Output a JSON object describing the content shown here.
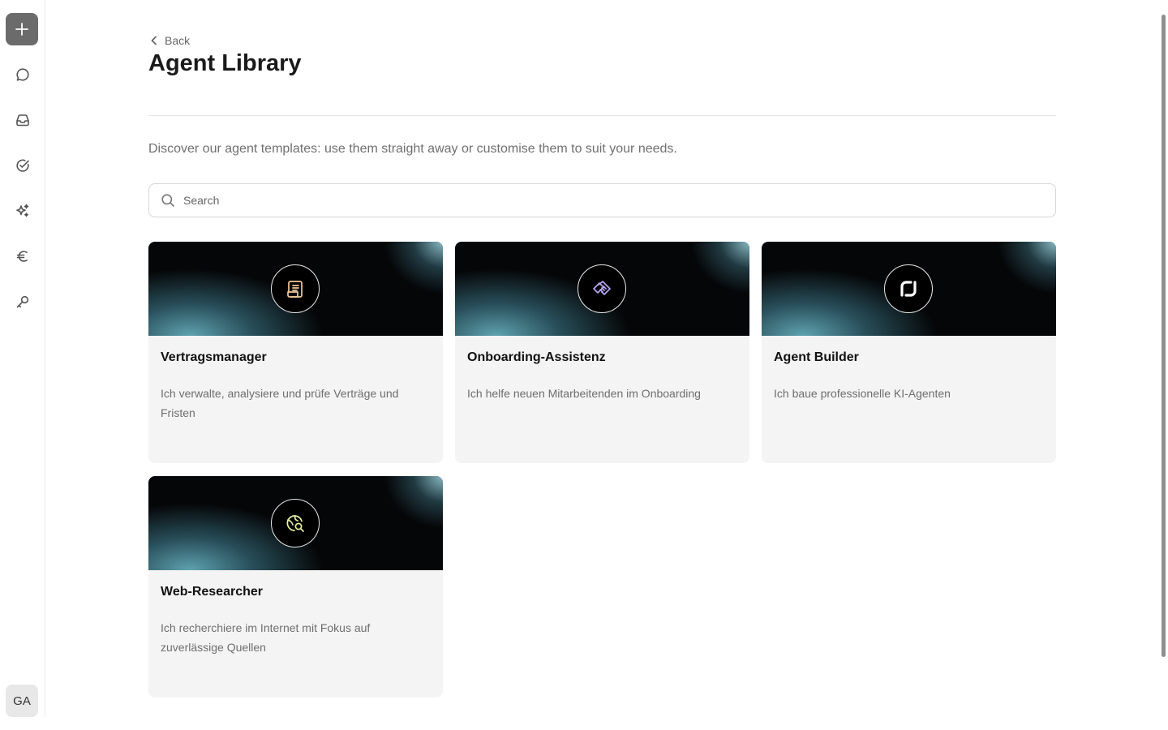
{
  "sidebar": {
    "avatar_initials": "GA",
    "icons": [
      "plus-icon",
      "chat-icon",
      "inbox-icon",
      "check-circle-icon",
      "sparkles-icon",
      "euro-icon",
      "key-icon"
    ]
  },
  "header": {
    "back_label": "Back",
    "title": "Agent Library"
  },
  "description": "Discover our agent templates: use them straight away or customise them to suit your needs.",
  "search": {
    "placeholder": "Search",
    "value": ""
  },
  "cards": [
    {
      "title": "Vertragsmanager",
      "description": "Ich verwalte, analysiere und prüfe Verträge und Fristen",
      "icon": "scroll-icon",
      "icon_color": "#f2c89a"
    },
    {
      "title": "Onboarding-Assistenz",
      "description": "Ich helfe neuen Mitarbeitenden im Onboarding",
      "icon": "handshake-icon",
      "icon_color": "#b9a6f2"
    },
    {
      "title": "Agent Builder",
      "description": "Ich baue professionelle KI-Agenten",
      "icon": "builder-logo-icon",
      "icon_color": "#ffffff"
    },
    {
      "title": "Web-Researcher",
      "description": "Ich recherchiere im Internet mit Fokus auf zuverlässige Quellen",
      "icon": "globe-search-icon",
      "icon_color": "#e8f0a0"
    }
  ],
  "colors": {
    "accent": "#6b6b6b",
    "card_bg": "#f4f4f4",
    "banner_dark": "#050607",
    "banner_glow": "#6ebecd"
  }
}
